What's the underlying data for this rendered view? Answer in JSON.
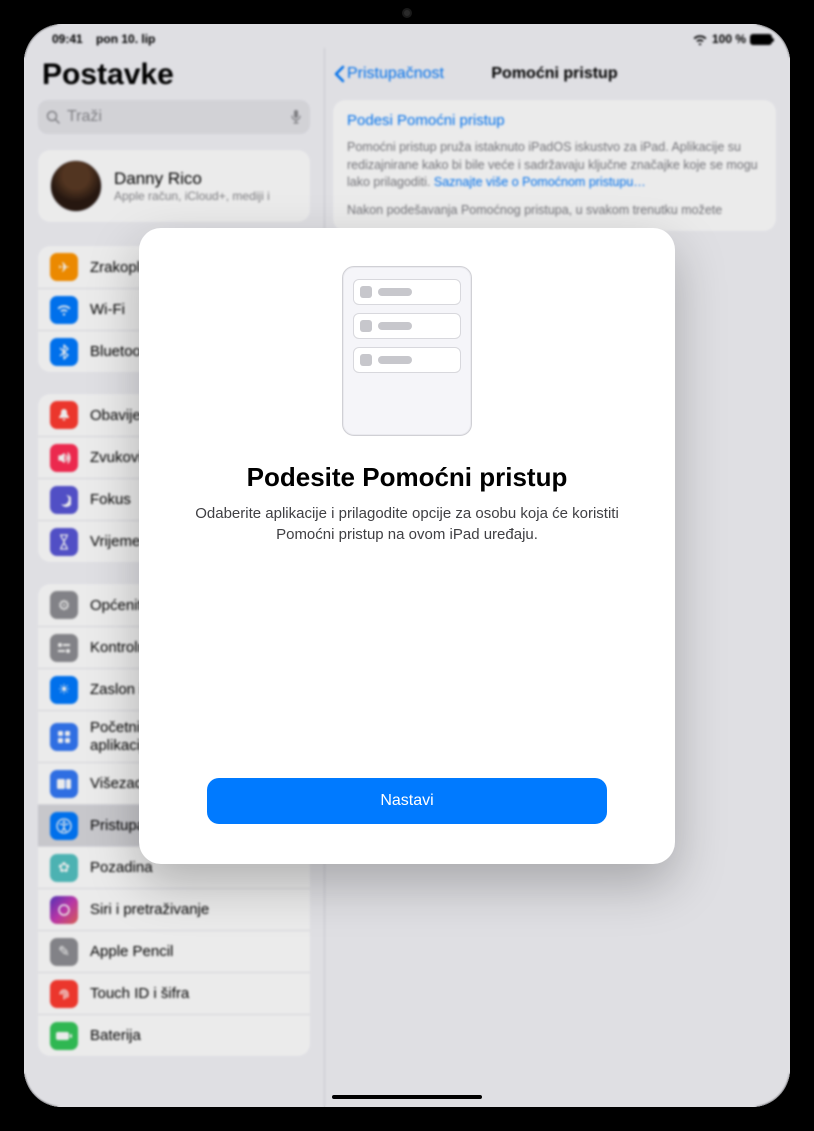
{
  "status": {
    "time": "09:41",
    "date": "pon 10. lip",
    "battery_text": "100 %"
  },
  "sidebar": {
    "title": "Postavke",
    "search_placeholder": "Traži",
    "profile": {
      "name": "Danny Rico",
      "subtitle": "Apple račun, iCloud+, mediji i"
    },
    "group1": [
      {
        "label": "Zrakoplovni način",
        "color": "#ff9500",
        "icon": "airplane"
      },
      {
        "label": "Wi-Fi",
        "color": "#007aff",
        "icon": "wifi"
      },
      {
        "label": "Bluetooth",
        "color": "#007aff",
        "icon": "bluetooth"
      }
    ],
    "group2": [
      {
        "label": "Obavijesti",
        "color": "#ff3b30",
        "icon": "bell"
      },
      {
        "label": "Zvukovi",
        "color": "#ff2d55",
        "icon": "speaker"
      },
      {
        "label": "Fokus",
        "color": "#5856d6",
        "icon": "moon"
      },
      {
        "label": "Vrijeme uporabe",
        "color": "#5856d6",
        "icon": "hourglass"
      }
    ],
    "group3": [
      {
        "label": "Općenito",
        "color": "#8e8e93",
        "icon": "gear"
      },
      {
        "label": "Kontrolni centar",
        "color": "#8e8e93",
        "icon": "switches"
      },
      {
        "label": "Zaslon i svjetlina",
        "color": "#007aff",
        "icon": "brightness"
      },
      {
        "label": "Početni zaslon i mediateka aplikacija",
        "color": "#3478f6",
        "icon": "grid"
      },
      {
        "label": "Višezadaćnost i geste",
        "color": "#3478f6",
        "icon": "multitask"
      },
      {
        "label": "Pristupačnost",
        "color": "#007aff",
        "icon": "accessibility",
        "selected": true
      },
      {
        "label": "Pozadina",
        "color": "#53c2c2",
        "icon": "flower"
      },
      {
        "label": "Siri i pretraživanje",
        "color": "#252528",
        "icon": "siri"
      },
      {
        "label": "Apple Pencil",
        "color": "#8e8e93",
        "icon": "pencil"
      },
      {
        "label": "Touch ID i šifra",
        "color": "#ff3b30",
        "icon": "touchid"
      },
      {
        "label": "Baterija",
        "color": "#34c759",
        "icon": "battery"
      }
    ]
  },
  "main": {
    "back_label": "Pristupačnost",
    "title": "Pomoćni pristup",
    "setup_link": "Podesi Pomoćni pristup",
    "desc1": "Pomoćni pristup pruža istaknuto iPadOS iskustvo za iPad. Aplikacije su redizajnirane kako bi bile veće i sadržavaju ključne značajke koje se mogu lako prilagoditi.",
    "learn_more": "Saznajte više o Pomoćnom pristupu…",
    "desc2": "Nakon podešavanja Pomoćnog pristupa, u svakom trenutku možete"
  },
  "modal": {
    "title": "Podesite Pomoćni pristup",
    "body": "Odaberite aplikacije i prilagodite opcije za osobu koja će koristiti Pomoćni pristup na ovom iPad uređaju.",
    "button": "Nastavi"
  }
}
